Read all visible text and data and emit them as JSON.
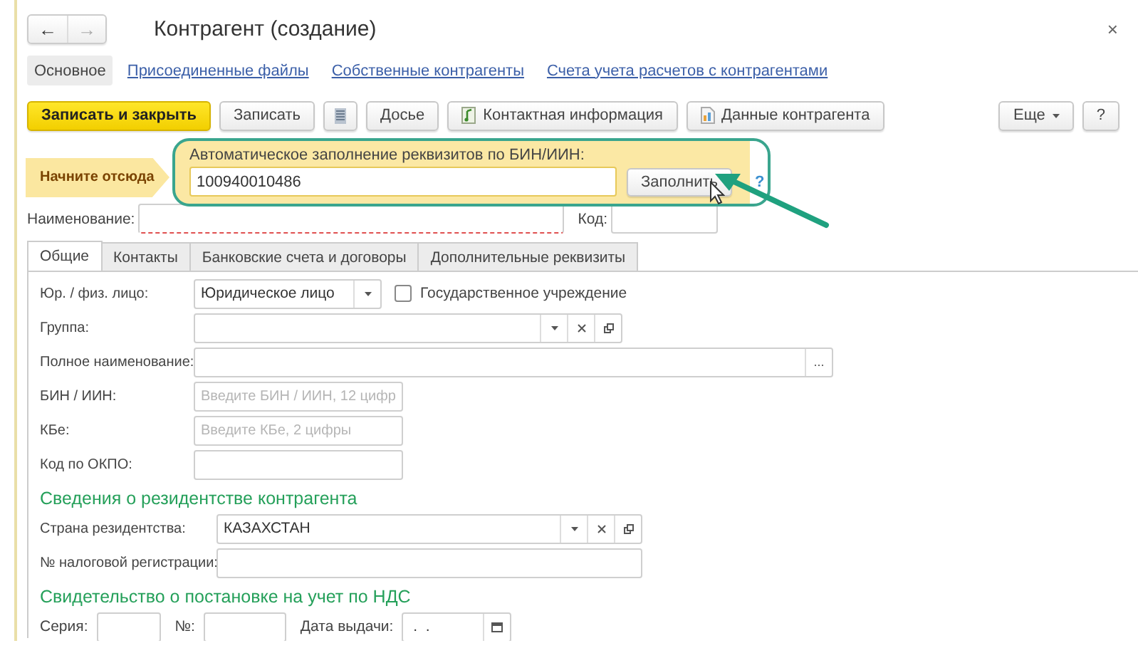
{
  "window": {
    "title": "Контрагент (создание)",
    "close": "×"
  },
  "nav_buttons": [
    {
      "label": "←",
      "disabled": false
    },
    {
      "label": "→",
      "disabled": true
    }
  ],
  "sections": [
    {
      "label": "Основное",
      "selected": true
    },
    {
      "label": "Присоединенные файлы",
      "selected": false
    },
    {
      "label": "Собственные контрагенты",
      "selected": false
    },
    {
      "label": "Счета учета расчетов с контрагентами",
      "selected": false
    }
  ],
  "toolbar": [
    {
      "kind": "primary",
      "label": "Записать и закрыть"
    },
    {
      "kind": "plain",
      "label": "Записать"
    },
    {
      "kind": "icon"
    },
    {
      "kind": "plain",
      "label": "Досье"
    },
    {
      "kind": "contact",
      "label": "Контактная информация"
    },
    {
      "kind": "report",
      "label": "Данные контрагента"
    },
    {
      "kind": "menu",
      "label": "Еще"
    },
    {
      "kind": "plain",
      "label": "?"
    }
  ],
  "autofill": {
    "hint": "Начните отсюда",
    "label": "Автоматическое заполнение реквизитов по БИН/ИИН:",
    "value": "100940010486",
    "button": "Заполнить",
    "help": "?"
  },
  "name_row": [
    {
      "label": "Наименование:",
      "required": true
    },
    {
      "label": "Код:",
      "required": false
    }
  ],
  "tabs": [
    {
      "label": "Общие",
      "selected": true
    },
    {
      "label": "Контакты",
      "selected": false
    },
    {
      "label": "Банковские счета и договоры",
      "selected": false
    },
    {
      "label": "Дополнительные реквизиты",
      "selected": false
    }
  ],
  "general": [
    {
      "kind": "dropdown",
      "label": "Юр. / физ. лицо:",
      "value": "Юридическое лицо",
      "checkbox": {
        "label": "Государственное учреждение",
        "checked": false
      }
    },
    {
      "kind": "reference",
      "label": "Группа:"
    },
    {
      "kind": "wide",
      "label": "Полное наименование:",
      "button": "..."
    },
    {
      "kind": "short",
      "label": "БИН / ИИН:",
      "placeholder": "Введите БИН / ИИН, 12 цифр"
    },
    {
      "kind": "short",
      "label": "КБе:",
      "placeholder": "Введите КБе, 2 цифры"
    },
    {
      "kind": "short",
      "label": "Код по ОКПО:"
    }
  ],
  "residency": {
    "heading": "Сведения о резидентстве контрагента",
    "fields": [
      {
        "kind": "reference",
        "label": "Страна резидентства:",
        "value": "КАЗАХСТАН"
      },
      {
        "kind": "medium",
        "label": "№ налоговой регистрации:"
      }
    ]
  },
  "vat": {
    "heading": "Свидетельство о постановке на учет по НДС",
    "fields": [
      {
        "kind": "tiny",
        "label": "Серия:"
      },
      {
        "kind": "small",
        "label": "№:"
      },
      {
        "kind": "date",
        "label": "Дата выдачи:",
        "value": " .  ."
      }
    ]
  }
}
